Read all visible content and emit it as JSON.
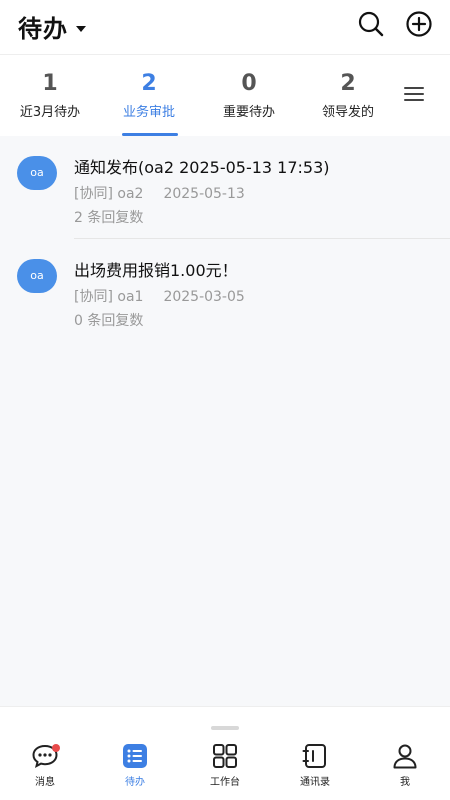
{
  "header": {
    "title": "待办"
  },
  "tabs": [
    {
      "count": "1",
      "label": "近3月待办"
    },
    {
      "count": "2",
      "label": "业务审批"
    },
    {
      "count": "0",
      "label": "重要待办"
    },
    {
      "count": "2",
      "label": "领导发的"
    }
  ],
  "items": [
    {
      "avatar": "oa",
      "title": "通知发布(oa2 2025-05-13 17:53)",
      "tag": "[协同] oa2",
      "date": "2025-05-13",
      "replies": "2 条回复数"
    },
    {
      "avatar": "oa",
      "title": "出场费用报销1.00元！",
      "tag": "[协同] oa1",
      "date": "2025-03-05",
      "replies": "0 条回复数"
    }
  ],
  "nav": [
    {
      "label": "消息"
    },
    {
      "label": "待办"
    },
    {
      "label": "工作台"
    },
    {
      "label": "通讯录"
    },
    {
      "label": "我"
    }
  ],
  "colors": {
    "accent": "#3d7fe3",
    "avatar": "#4a90e8",
    "badge": "#e84a4a"
  }
}
